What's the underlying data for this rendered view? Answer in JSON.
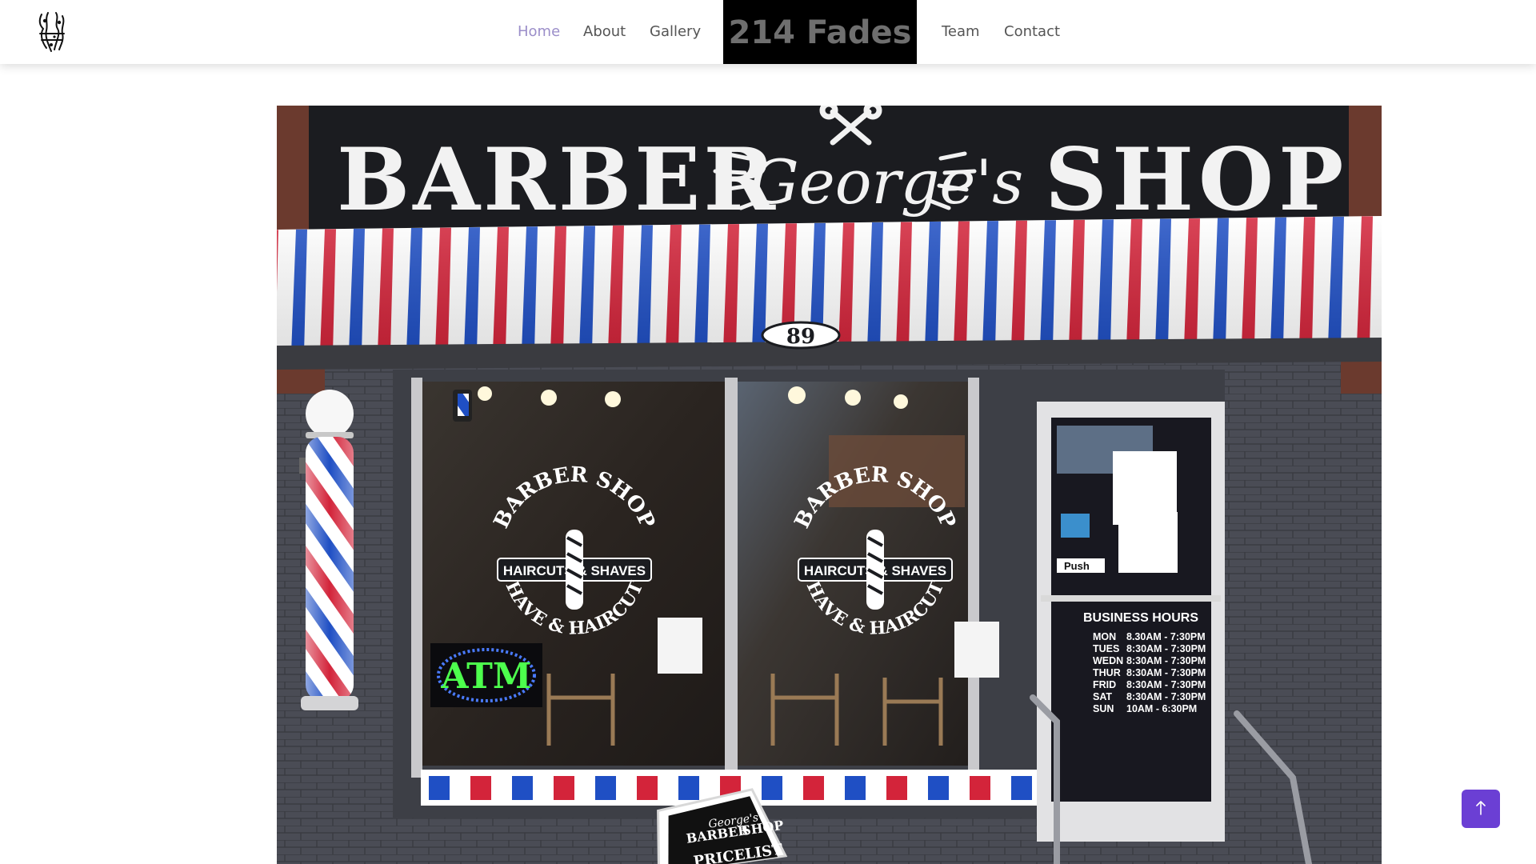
{
  "nav": {
    "links_left": [
      {
        "label": "Home",
        "active": true
      },
      {
        "label": "About",
        "active": false
      },
      {
        "label": "Gallery",
        "active": false
      }
    ],
    "brand": "214 Fades",
    "links_right": [
      {
        "label": "Team",
        "active": false
      },
      {
        "label": "Contact",
        "active": false
      }
    ],
    "logo_icon": "fade-logo-icon"
  },
  "hero_photo": {
    "sign": {
      "left_word": "BARBER",
      "script": "George's",
      "right_word": "SHOP"
    },
    "awning_number": "89",
    "window_decal": {
      "top_arc": "BARBER SHOP",
      "middle": "HAIRCUTS & SHAVES",
      "bottom_arc": "SHAVE & HAIRCUTS"
    },
    "atm_sign": "ATM",
    "door_push": "Push",
    "business_hours": {
      "title": "BUSINESS HOURS",
      "rows": [
        {
          "day": "MON",
          "hours": "8.30AM - 7:30PM"
        },
        {
          "day": "TUES",
          "hours": "8:30AM - 7:30PM"
        },
        {
          "day": "WEDN",
          "hours": "8:30AM - 7:30PM"
        },
        {
          "day": "THUR",
          "hours": "8:30AM - 7:30PM"
        },
        {
          "day": "FRID",
          "hours": "8:30AM - 7:30PM"
        },
        {
          "day": "SAT",
          "hours": "8:30AM - 7:30PM"
        },
        {
          "day": "SUN",
          "hours": "10AM -  6:30PM"
        }
      ]
    },
    "sandwich_board": {
      "line1": "BARBER",
      "line2": "George's",
      "line3": "SHOP",
      "line4": "PRICELIST"
    },
    "colors": {
      "stripe_red": "#d3243a",
      "stripe_blue": "#1f4fc4",
      "sign_black": "#1b1c20",
      "brick": "#4a4c55"
    }
  },
  "back_to_top": {
    "icon": "arrow-up-icon",
    "color": "#6b3fd4"
  }
}
